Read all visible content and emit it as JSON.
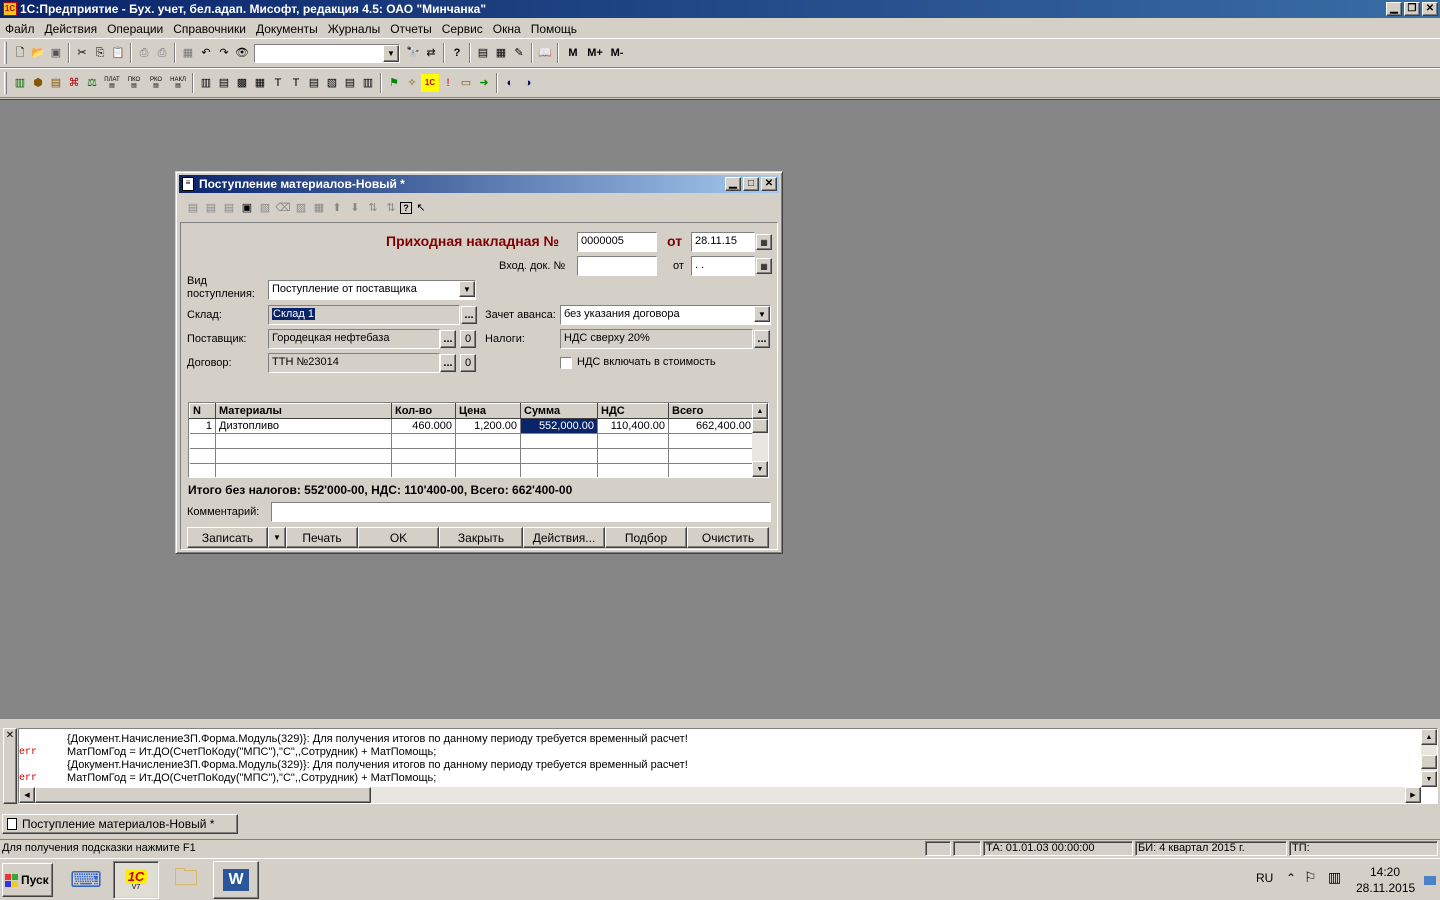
{
  "app": {
    "title": "1С:Предприятие - Бух. учет, бел.адап. Мисофт, редакция 4.5: ОАО \"Минчанка\""
  },
  "menu": [
    "Файл",
    "Действия",
    "Операции",
    "Справочники",
    "Документы",
    "Журналы",
    "Отчеты",
    "Сервис",
    "Окна",
    "Помощь"
  ],
  "toolbar1": {
    "m_buttons": [
      "M",
      "M+",
      "M-"
    ]
  },
  "toolbar2": {
    "small_labels": [
      "ПЛАТ",
      "ПКО",
      "РКО",
      "НАКЛ"
    ]
  },
  "dialog": {
    "title": "Поступление материалов-Новый *",
    "header": "Приходная накладная №",
    "doc_number": "0000005",
    "from_label": "от",
    "doc_date": "28.11.15",
    "incoming_doc_label": "Вход. док. №",
    "incoming_doc_value": "",
    "incoming_from_label": "от",
    "incoming_date": " .  . ",
    "receipt_type_label1": "Вид",
    "receipt_type_label2": "поступления:",
    "receipt_type_value": "Поступление от поставщика",
    "warehouse_label": "Склад:",
    "warehouse_value": "Склад 1",
    "supplier_label": "Поставщик:",
    "supplier_value": "Городецкая нефтебаза",
    "contract_label": "Договор:",
    "contract_value": "ТТН №23014",
    "advance_label": "Зачет аванса:",
    "advance_value": "без указания договора",
    "taxes_label": "Налоги:",
    "taxes_value": "НДС сверху 20%",
    "vat_include_label": "НДС включать в стоимость",
    "zero_btn": "0",
    "ellipsis": "...",
    "table": {
      "headers": [
        "N",
        "Материалы",
        "Кол-во",
        "Цена",
        "Сумма",
        "НДС",
        "Всего"
      ],
      "rows": [
        [
          "1",
          "Дизтопливо",
          "460.000",
          "1,200.00",
          "552,000.00",
          "110,400.00",
          "662,400.00"
        ]
      ]
    },
    "totals": "Итого без налогов: 552'000-00, НДС: 110'400-00, Всего: 662'400-00",
    "comment_label": "Комментарий:",
    "comment_value": "",
    "buttons": {
      "save": "Записать",
      "print": "Печать",
      "ok": "OK",
      "close": "Закрыть",
      "actions": "Действия...",
      "selection": "Подбор",
      "clear": "Очистить"
    }
  },
  "messages": [
    {
      "tag": "",
      "text": "{Документ.НачислениеЗП.Форма.Модуль(329)}: Для получения итогов по данному периоду требуется временный расчет!"
    },
    {
      "tag": "err",
      "text": "МатПомГод = Ит.ДО(СчетПоКоду(\"МПС\"),\"С\",,Сотрудник) + МатПомощь;"
    },
    {
      "tag": "",
      "text": "{Документ.НачислениеЗП.Форма.Модуль(329)}: Для получения итогов по данному периоду требуется временный расчет!"
    },
    {
      "tag": "err",
      "text": "МатПомГод = Ит.ДО(СчетПоКоду(\"МПС\"),\"С\",,Сотрудник) + МатПомощь;"
    }
  ],
  "window_tab": "Поступление материалов-Новый *",
  "status": {
    "hint": "Для получения подсказки нажмите F1",
    "ta": "ТА: 01.01.03  00:00:00",
    "bi": "БИ: 4 квартал 2015 г.",
    "tp": "ТП:"
  },
  "taskbar": {
    "start": "Пуск",
    "lang": "RU",
    "time": "14:20",
    "date": "28.11.2015",
    "v77": "V7"
  }
}
